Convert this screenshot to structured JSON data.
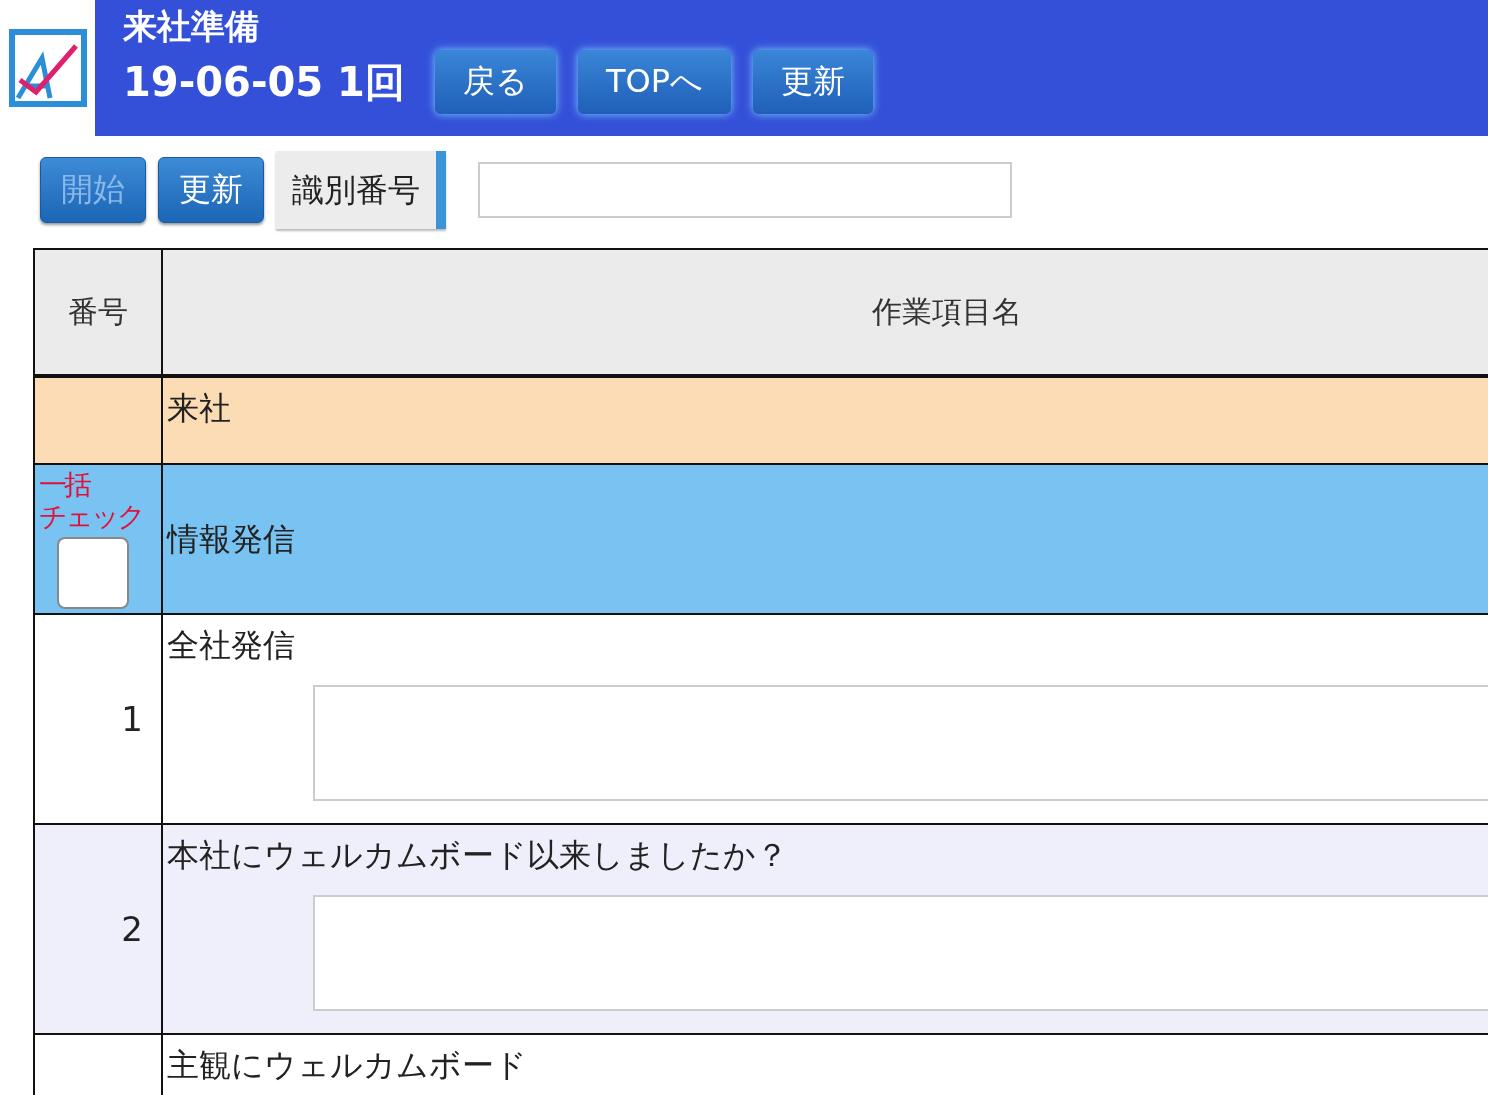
{
  "header": {
    "title": "来社準備",
    "subtitle": "19-06-05 1回",
    "buttons": [
      "戻る",
      "TOPへ",
      "更新"
    ]
  },
  "toolbar": {
    "buttons": [
      {
        "label": "開始",
        "disabled": true
      },
      {
        "label": "更新",
        "disabled": false
      }
    ],
    "id_label": "識別番号"
  },
  "table": {
    "columns": [
      "番号",
      "作業項目名"
    ],
    "rows": [
      {
        "kind": "category",
        "name": "来社"
      },
      {
        "kind": "group",
        "name": "情報発信",
        "bulk_label": [
          "一括",
          "チェック"
        ],
        "checked": false
      },
      {
        "kind": "item",
        "number": "1",
        "name": "全社発信",
        "shaded": false
      },
      {
        "kind": "item",
        "number": "2",
        "name": "本社にウェルカムボード以来しましたか？",
        "shaded": true
      },
      {
        "kind": "item",
        "name": "主観にウェルカムボード",
        "shaded": false
      }
    ]
  }
}
